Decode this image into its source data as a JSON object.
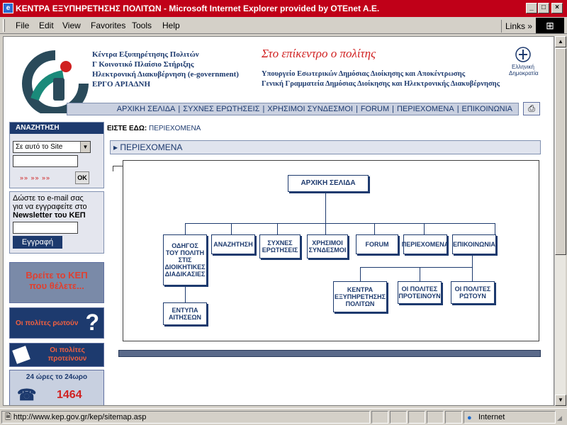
{
  "window": {
    "title": "ΚΕΝΤΡΑ ΕΞΥΠΗΡΕΤΗΣΗΣ ΠΟΛΙΤΩΝ - Microsoft Internet Explorer provided by OTEnet A.E.",
    "controls": {
      "minimize": "_",
      "maximize": "□",
      "close": "×"
    }
  },
  "menu": {
    "items": [
      "File",
      "Edit",
      "View",
      "Favorites",
      "Tools",
      "Help"
    ],
    "links_label": "Links"
  },
  "header": {
    "left_lines": [
      "Κέντρα Εξυπηρέτησης Πολιτών",
      "Γ Κοινοτικό Πλαίσιο Στήριξης",
      "Ηλεκτρονική Διακυβέρνηση (e-government)",
      "ΕΡΓΟ ΑΡΙΑΔΝΗ"
    ],
    "slogan": "Στο επίκεντρο ο πολίτης",
    "ministry_lines": [
      "Υπουργείο Εσωτερικών Δημόσιας Διοίκησης και Αποκέντρωσης",
      "Γενική Γραμματεία Δημόσιας Διοίκησης και Ηλεκτρονικής Διακυβέρνησης"
    ],
    "emblem_text": "Ελληνική Δημοκρατία"
  },
  "nav": {
    "items": [
      "ΑΡΧΙΚΗ ΣΕΛΙΔΑ",
      "ΣΥΧΝΕΣ ΕΡΩΤΗΣΕΙΣ",
      "ΧΡΗΣΙΜΟΙ ΣΥΝΔΕΣΜΟΙ",
      "FORUM",
      "ΠΕΡΙΕΧΟΜΕΝΑ",
      "ΕΠΙΚΟΙΝΩΝΙΑ"
    ],
    "separator": "|"
  },
  "search": {
    "heading": "ΑΝΑΖΗΤΗΣΗ",
    "scope_selected": "Σε αυτό το Site",
    "query_value": "",
    "arrows": "»» »» »»",
    "ok_label": "OK"
  },
  "newsletter": {
    "text_lines": [
      "Δώστε το e-mail σας",
      "για να εγγραφείτε στο"
    ],
    "bold_line": "Newsletter του ΚΕΠ",
    "email_value": "",
    "register_label": "Εγγραφή"
  },
  "banners": {
    "find_kep": [
      "Βρείτε το ΚΕΠ",
      "που θέλετε..."
    ],
    "citizens_ask": "Οι πολίτες ρωτούν",
    "citizens_propose": [
      "Οι πολίτες",
      "προτείνουν"
    ],
    "hotline_text": "24 ώρες το 24ωρο",
    "hotline_number": "1464"
  },
  "breadcrumb": {
    "label": "ΕΙΣΤΕ ΕΔΩ:",
    "current": "ΠΕΡΙΕΧΟΜΕΝΑ"
  },
  "section": {
    "title": "ΠΕΡΙΕΧΟΜΕΝΑ"
  },
  "sitemap": {
    "root": "ΑΡΧΙΚΗ ΣΕΛΙΔΑ",
    "guide": "ΟΔΗΓΟΣ ΤΟΥ ΠΟΛΙΤΗ ΣΤΙΣ ΔΙΟΙΚΗΤΙΚΕΣ ΔΙΑΔΙΚΑΣΙΕΣ",
    "search": "ΑΝΑΖΗΤΗΣΗ",
    "faq": "ΣΥΧΝΕΣ ΕΡΩΤΗΣΕΙΣ",
    "links": "ΧΡΗΣΙΜΟΙ ΣΥΝΔΕΣΜΟΙ",
    "forum": "FORUM",
    "contents": "ΠΕΡΙΕΧΟΜΕΝΑ",
    "contact": "ΕΠΙΚΟΙΝΩΝΙΑ",
    "forms": "ΕΝΤΥΠΑ ΑΙΤΗΣΕΩΝ",
    "centers": "ΚΕΝΤΡΑ ΕΞΥΠΗΡΕΤΗΣΗΣ ΠΟΛΙΤΩΝ",
    "propose": "ΟΙ ΠΟΛΙΤΕΣ ΠΡΟΤΕΙΝΟΥΝ",
    "ask": "ΟΙ ΠΟΛΙΤΕΣ ΡΩΤΟΥΝ"
  },
  "status": {
    "url": "http://www.kep.gov.gr/kep/sitemap.asp",
    "zone": "Internet"
  }
}
